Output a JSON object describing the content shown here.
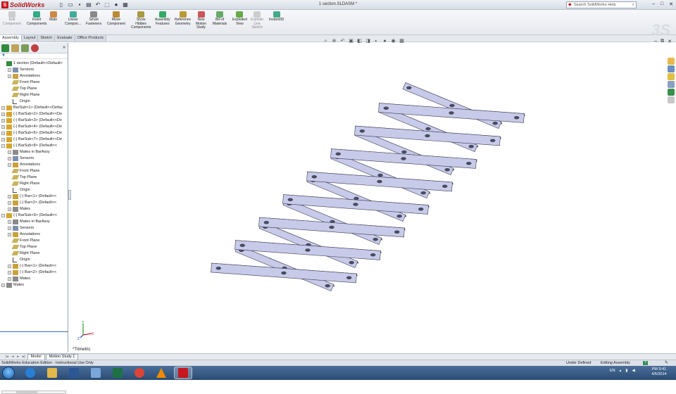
{
  "titlebar": {
    "app_name": "SolidWorks",
    "document_title": "1 section.SLDASM *",
    "search_placeholder": "Search SolidWorks Help",
    "minimize": "–",
    "restore": "□",
    "close": "✕",
    "quick_access": [
      "new-icon",
      "open-icon",
      "save-icon",
      "print-icon",
      "undo-icon",
      "select-icon",
      "rebuild-icon",
      "options-icon"
    ]
  },
  "commands": [
    {
      "name": "edit-component",
      "label": "Edit\nComponent",
      "disabled": true
    },
    {
      "name": "insert-components",
      "label": "Insert\nComponents",
      "disabled": false
    },
    {
      "name": "mate",
      "label": "Mate",
      "disabled": false
    },
    {
      "name": "linear-component",
      "label": "Linear\nCompon...",
      "disabled": false
    },
    {
      "name": "smart-fasteners",
      "label": "Smart\nFasteners",
      "disabled": false
    },
    {
      "name": "move-component",
      "label": "Move\nComponent",
      "disabled": false
    },
    {
      "name": "show-hidden-components",
      "label": "Show\nHidden\nComponents",
      "disabled": false
    },
    {
      "name": "assembly-features",
      "label": "Assembly\nFeatures",
      "disabled": false
    },
    {
      "name": "reference-geometry",
      "label": "Reference\nGeometry",
      "disabled": false
    },
    {
      "name": "new-motion-study",
      "label": "New\nMotion\nStudy",
      "disabled": false
    },
    {
      "name": "bill-of-materials",
      "label": "Bill of\nMaterials",
      "disabled": false
    },
    {
      "name": "exploded-view",
      "label": "Exploded\nView",
      "disabled": false
    },
    {
      "name": "explode-line-sketch",
      "label": "Explode\nLine\nSketch",
      "disabled": true
    },
    {
      "name": "instant3d",
      "label": "Instant3D",
      "disabled": false
    }
  ],
  "tabs": [
    "Assembly",
    "Layout",
    "Sketch",
    "Evaluate",
    "Office Products"
  ],
  "active_tab": "Assembly",
  "tree": [
    {
      "depth": 0,
      "pm": "",
      "icon": "assembly",
      "label": "1 section  (Default<<Default>"
    },
    {
      "depth": 1,
      "pm": "+",
      "icon": "sensor",
      "label": "Sensors"
    },
    {
      "depth": 1,
      "pm": "+",
      "icon": "annotation",
      "label": "Annotations"
    },
    {
      "depth": 1,
      "pm": "",
      "icon": "plane",
      "label": "Front Plane"
    },
    {
      "depth": 1,
      "pm": "",
      "icon": "plane",
      "label": "Top Plane"
    },
    {
      "depth": 1,
      "pm": "",
      "icon": "plane",
      "label": "Right Plane"
    },
    {
      "depth": 1,
      "pm": "",
      "icon": "origin",
      "label": "Origin"
    },
    {
      "depth": 0,
      "pm": "+",
      "icon": "subassembly",
      "label": "BarSub<1> (Default<<Defau"
    },
    {
      "depth": 0,
      "pm": "+",
      "icon": "subassembly",
      "label": "(-) BarSub<2> (Default<<De"
    },
    {
      "depth": 0,
      "pm": "+",
      "icon": "subassembly",
      "label": "(-) BarSub<3> (Default<<De"
    },
    {
      "depth": 0,
      "pm": "+",
      "icon": "subassembly",
      "label": "(-) BarSub<4> (Default<<De"
    },
    {
      "depth": 0,
      "pm": "+",
      "icon": "subassembly",
      "label": "(-) BarSub<6> (Default<<De"
    },
    {
      "depth": 0,
      "pm": "+",
      "icon": "subassembly",
      "label": "(-) BarSub<7> (Default<<De"
    },
    {
      "depth": 0,
      "pm": "−",
      "icon": "subassembly",
      "label": "(-) BarSub<8> (Default<<"
    },
    {
      "depth": 1,
      "pm": "+",
      "icon": "mates",
      "label": "Mates in BarAssy"
    },
    {
      "depth": 1,
      "pm": "+",
      "icon": "sensor",
      "label": "Sensors"
    },
    {
      "depth": 1,
      "pm": "+",
      "icon": "annotation",
      "label": "Annotations"
    },
    {
      "depth": 1,
      "pm": "",
      "icon": "plane",
      "label": "Front Plane"
    },
    {
      "depth": 1,
      "pm": "",
      "icon": "plane",
      "label": "Top Plane"
    },
    {
      "depth": 1,
      "pm": "",
      "icon": "plane",
      "label": "Right Plane"
    },
    {
      "depth": 1,
      "pm": "",
      "icon": "origin",
      "label": "Origin"
    },
    {
      "depth": 1,
      "pm": "+",
      "icon": "part",
      "label": "(-) Bar<1> (Default<<"
    },
    {
      "depth": 1,
      "pm": "+",
      "icon": "part",
      "label": "(-) Bar<2> (Default<<"
    },
    {
      "depth": 1,
      "pm": "+",
      "icon": "mates",
      "label": "Mates"
    },
    {
      "depth": 0,
      "pm": "−",
      "icon": "subassembly",
      "label": "(-) BarSub<9> (Default<<"
    },
    {
      "depth": 1,
      "pm": "+",
      "icon": "mates",
      "label": "Mates in BarAssy"
    },
    {
      "depth": 1,
      "pm": "+",
      "icon": "sensor",
      "label": "Sensors"
    },
    {
      "depth": 1,
      "pm": "+",
      "icon": "annotation",
      "label": "Annotations"
    },
    {
      "depth": 1,
      "pm": "",
      "icon": "plane",
      "label": "Front Plane"
    },
    {
      "depth": 1,
      "pm": "",
      "icon": "plane",
      "label": "Top Plane"
    },
    {
      "depth": 1,
      "pm": "",
      "icon": "plane",
      "label": "Right Plane"
    },
    {
      "depth": 1,
      "pm": "",
      "icon": "origin",
      "label": "Origin"
    },
    {
      "depth": 1,
      "pm": "+",
      "icon": "part",
      "label": "(-) Bar<1> (Default<<"
    },
    {
      "depth": 1,
      "pm": "+",
      "icon": "part",
      "label": "(-) Bar<2> (Default<<"
    },
    {
      "depth": 1,
      "pm": "+",
      "icon": "mates",
      "label": "Mates"
    },
    {
      "depth": 0,
      "pm": "+",
      "icon": "mates",
      "label": "Mates"
    }
  ],
  "viewport": {
    "view_label": "*Trimetric",
    "triad_labels": {
      "x": "X",
      "y": "Y",
      "z": "Z"
    },
    "bar_count": 8,
    "bar_color": "#c7cae8"
  },
  "bottom_tabs": [
    "Model",
    "Motion Study 1"
  ],
  "active_bottom_tab": "Model",
  "status": {
    "left": "SolidWorks Education Edition - Instructional Use Only",
    "definition": "Under Defined",
    "mode": "Editing Assembly",
    "help": "?"
  },
  "taskbar": {
    "apps": [
      "internet-explorer",
      "file-explorer",
      "word",
      "paint",
      "excel",
      "chrome",
      "vlc",
      "solidworks"
    ],
    "language": "EN",
    "time": "PM 9:41",
    "date": "4/5/2014"
  },
  "colors": {
    "accent": "#c8171e",
    "selection": "#3a6fc4",
    "taskbar": "#2a4a72"
  }
}
